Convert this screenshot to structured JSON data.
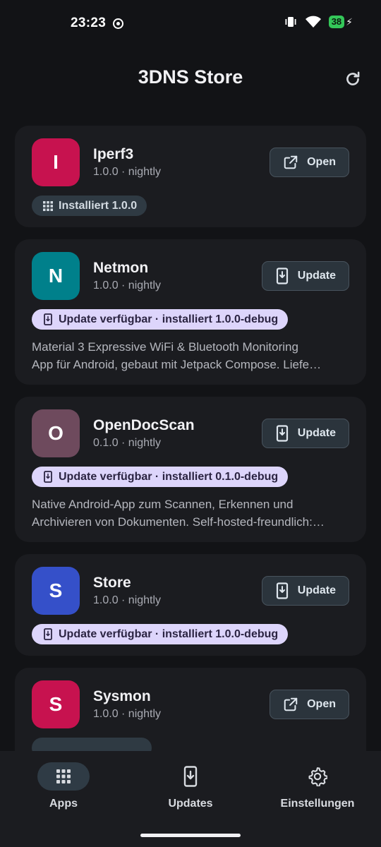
{
  "status_bar": {
    "time": "23:23",
    "battery": "38"
  },
  "header": {
    "title": "3DNS Store"
  },
  "apps": [
    {
      "initial": "I",
      "name": "Iperf3",
      "version": "1.0.0 · nightly",
      "color": "#c7124f",
      "action": "Open",
      "action_icon": "open-external-icon",
      "badge": "Installiert 1.0.0",
      "badge_type": "installed",
      "description": []
    },
    {
      "initial": "N",
      "name": "Netmon",
      "version": "1.0.0 · nightly",
      "color": "#00808b",
      "action": "Update",
      "action_icon": "update-download-icon",
      "badge": "Update verfügbar · installiert 1.0.0-debug",
      "badge_type": "update",
      "description": [
        "Material 3 Expressive WiFi & Bluetooth Monitoring",
        "App für Android, gebaut mit Jetpack Compose. Liefe…"
      ]
    },
    {
      "initial": "O",
      "name": "OpenDocScan",
      "version": "0.1.0 · nightly",
      "color": "#6e4a5d",
      "action": "Update",
      "action_icon": "update-download-icon",
      "badge": "Update verfügbar · installiert 0.1.0-debug",
      "badge_type": "update",
      "description": [
        "Native Android-App zum Scannen, Erkennen und",
        "Archivieren von Dokumenten. Self-hosted-freundlich:…"
      ]
    },
    {
      "initial": "S",
      "name": "Store",
      "version": "1.0.0 · nightly",
      "color": "#3550c9",
      "action": "Update",
      "action_icon": "update-download-icon",
      "badge": "Update verfügbar · installiert 1.0.0-debug",
      "badge_type": "update",
      "description": []
    },
    {
      "initial": "S",
      "name": "Sysmon",
      "version": "1.0.0 · nightly",
      "color": "#c7124f",
      "action": "Open",
      "action_icon": "open-external-icon",
      "badge": "",
      "badge_type": "installed",
      "description": []
    }
  ],
  "bottom_nav": [
    {
      "label": "Apps",
      "icon": "apps-grid-icon",
      "active": true
    },
    {
      "label": "Updates",
      "icon": "updates-phone-icon",
      "active": false
    },
    {
      "label": "Einstellungen",
      "icon": "settings-gear-icon",
      "active": false
    }
  ]
}
